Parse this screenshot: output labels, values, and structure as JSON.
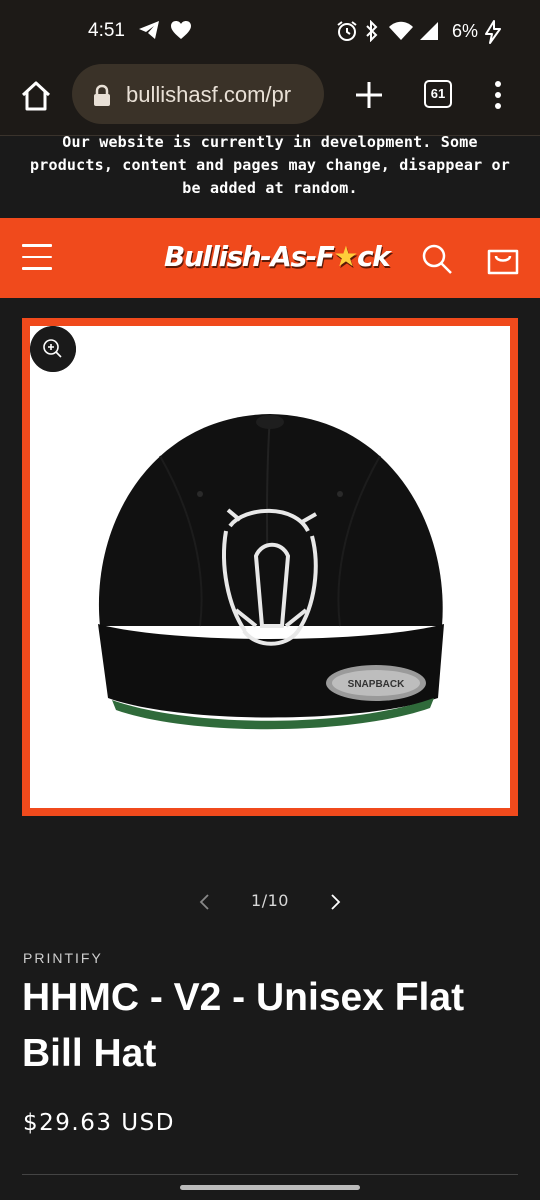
{
  "status_bar": {
    "time": "4:51",
    "battery": "6%",
    "icons": [
      "telegram-icon",
      "heart-icon",
      "alarm-icon",
      "bluetooth-icon",
      "wifi-icon",
      "signal-icon",
      "charging-icon"
    ]
  },
  "browser": {
    "url": "bullishasf.com/pr",
    "tab_count": "61"
  },
  "announcement": {
    "text": "Our website is currently in development. Some products, content and pages may change, disappear or be added at random."
  },
  "header": {
    "logo_prefix": "Bullish-As-F",
    "logo_star": "★",
    "logo_suffix": "ck",
    "accent_color": "#f04a1c"
  },
  "product": {
    "vendor": "PRINTIFY",
    "title": "HHMC - V2 - Unisex Flat Bill Hat",
    "price": "$29.63 USD",
    "slide_counter": "1/10",
    "patch_text": "SNAPBACK"
  }
}
